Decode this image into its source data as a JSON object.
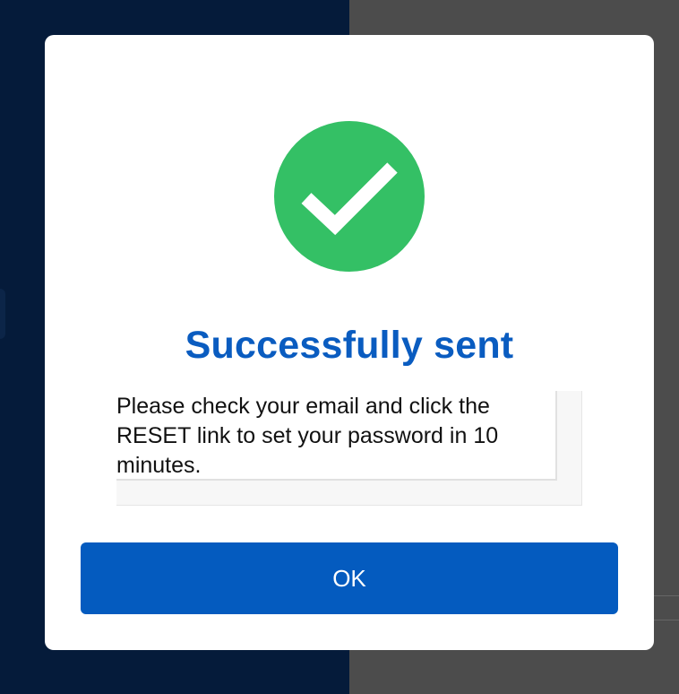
{
  "dialog": {
    "title": "Successfully sent",
    "message": "Please check your email and click the RESET link to set your password in 10 minutes.",
    "ok_label": "OK",
    "icon": "check-circle-icon"
  },
  "colors": {
    "success_green": "#34c065",
    "title_blue": "#0a5cc0",
    "button_blue": "#045bbf",
    "backdrop_left": "#051b3a",
    "backdrop_right": "#4c4c4c"
  }
}
